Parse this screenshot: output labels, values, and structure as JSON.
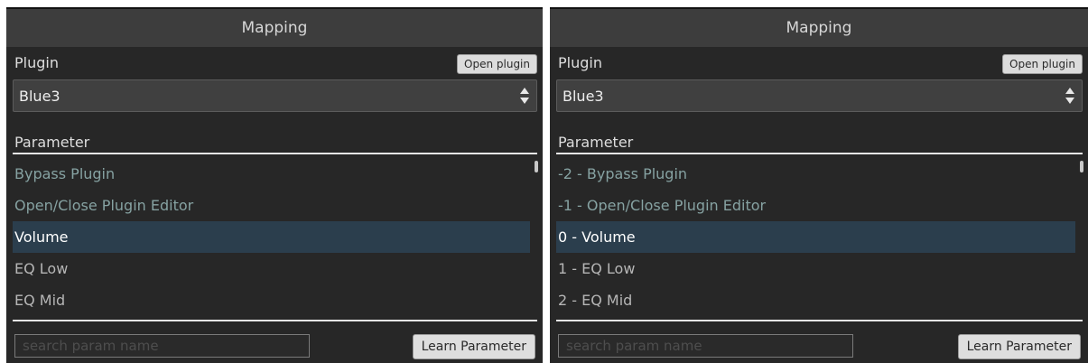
{
  "panels": [
    {
      "header": "Mapping",
      "plugin_label": "Plugin",
      "open_plugin_label": "Open plugin",
      "selected_plugin": "Blue3",
      "parameter_header": "Parameter",
      "items": [
        {
          "label": "Bypass Plugin",
          "kind": "meta",
          "selected": false
        },
        {
          "label": "Open/Close Plugin Editor",
          "kind": "meta",
          "selected": false
        },
        {
          "label": "Volume",
          "kind": "param",
          "selected": true
        },
        {
          "label": "EQ Low",
          "kind": "param",
          "selected": false
        },
        {
          "label": "EQ Mid",
          "kind": "param",
          "selected": false
        }
      ],
      "search_placeholder": "search param name",
      "learn_label": "Learn Parameter"
    },
    {
      "header": "Mapping",
      "plugin_label": "Plugin",
      "open_plugin_label": "Open plugin",
      "selected_plugin": "Blue3",
      "parameter_header": "Parameter",
      "items": [
        {
          "label": "-2 - Bypass Plugin",
          "kind": "meta",
          "selected": false
        },
        {
          "label": "-1 - Open/Close Plugin Editor",
          "kind": "meta",
          "selected": false
        },
        {
          "label": "0 - Volume",
          "kind": "param",
          "selected": true
        },
        {
          "label": "1 - EQ Low",
          "kind": "param",
          "selected": false
        },
        {
          "label": "2 - EQ Mid",
          "kind": "param",
          "selected": false
        }
      ],
      "search_placeholder": "search param name",
      "learn_label": "Learn Parameter"
    }
  ],
  "icons": {
    "select_arrows": "updown-chevron-icon",
    "scroll": "scrollbar"
  },
  "colors": {
    "panel_bg": "#272727",
    "header_bg": "#3d3d3d",
    "meta_item": "#86a2a2",
    "normal_item": "#b6b6b6",
    "selected_bg": "#2b3e4d",
    "button_bg": "#dedede"
  }
}
